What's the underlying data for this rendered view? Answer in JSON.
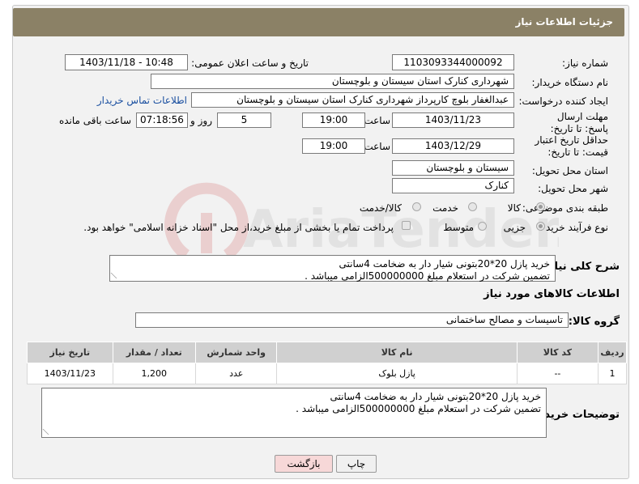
{
  "page": {
    "title": "جزئیات اطلاعات نیاز"
  },
  "form": {
    "need_number_label": "شماره نیاز:",
    "need_number": "1103093344000092",
    "announce_datetime_label": "تاریخ و ساعت اعلان عمومی:",
    "announce_datetime": "1403/11/18 - 10:48",
    "buyer_org_label": "نام دستگاه خریدار:",
    "buyer_org": "شهرداری کنارک استان سیستان و بلوچستان",
    "requester_label": "ایجاد کننده درخواست:",
    "requester": "عبدالغفار بلوچ کارپرداز شهرداری کنارک استان سیستان و بلوچستان",
    "contact_link": "اطلاعات تماس خریدار",
    "reply_deadline_label": "مهلت ارسال پاسخ: تا تاریخ:",
    "reply_date": "1403/11/23",
    "time_label": "ساعت",
    "reply_time": "19:00",
    "days_value": "5",
    "days_label": "روز و",
    "remaining_time": "07:18:56",
    "remaining_label": "ساعت باقی مانده",
    "price_validity_label": "حداقل تاریخ اعتبار قیمت: تا تاریخ:",
    "validity_date": "1403/12/29",
    "validity_time": "19:00",
    "province_label": "استان محل تحویل:",
    "province": "سیستان و بلوچستان",
    "city_label": "شهر محل تحویل:",
    "city": "کنارک",
    "category_label": "طبقه بندی موضوعی:",
    "category_options": [
      "کالا",
      "خدمت",
      "کالا/خدمت"
    ],
    "process_label": "نوع فرآیند خرید :",
    "process_options": [
      "جزیی",
      "متوسط"
    ],
    "payment_note": "پرداخت تمام یا بخشی از مبلغ خرید،از محل \"اسناد خزانه اسلامی\" خواهد بود.",
    "description_label": "شرح کلی نیاز:",
    "description_line1": "خرید پازل 20*20بتونی شیار دار به ضخامت 4سانتی",
    "description_line2": "تضمین شرکت در استعلام مبلغ 500000000الزامی میباشد .",
    "goods_info_title": "اطلاعات کالاهای مورد نیاز",
    "goods_group_label": "گروه کالا:",
    "goods_group": "تاسیسات و مصالح ساختمانی",
    "buyer_notes_label": "توضیحات خریدار:",
    "notes_line1": "خرید پازل 20*20بتونی شیار دار به ضخامت 4سانتی",
    "notes_line2": "تضمین شرکت در استعلام مبلغ 500000000الزامی میباشد ."
  },
  "table": {
    "headers": [
      "ردیف",
      "کد کالا",
      "نام کالا",
      "واحد شمارش",
      "تعداد / مقدار",
      "تاریخ نیاز"
    ],
    "rows": [
      [
        "1",
        "--",
        "پازل بلوک",
        "عدد",
        "1,200",
        "1403/11/23"
      ]
    ]
  },
  "buttons": {
    "print": "چاپ",
    "back": "بازگشت"
  },
  "watermark": "AriaTender.neT",
  "colors": {
    "header_bg": "#8b8166",
    "back_button_bg": "#f7d8d8",
    "link": "#1a4fa0"
  }
}
